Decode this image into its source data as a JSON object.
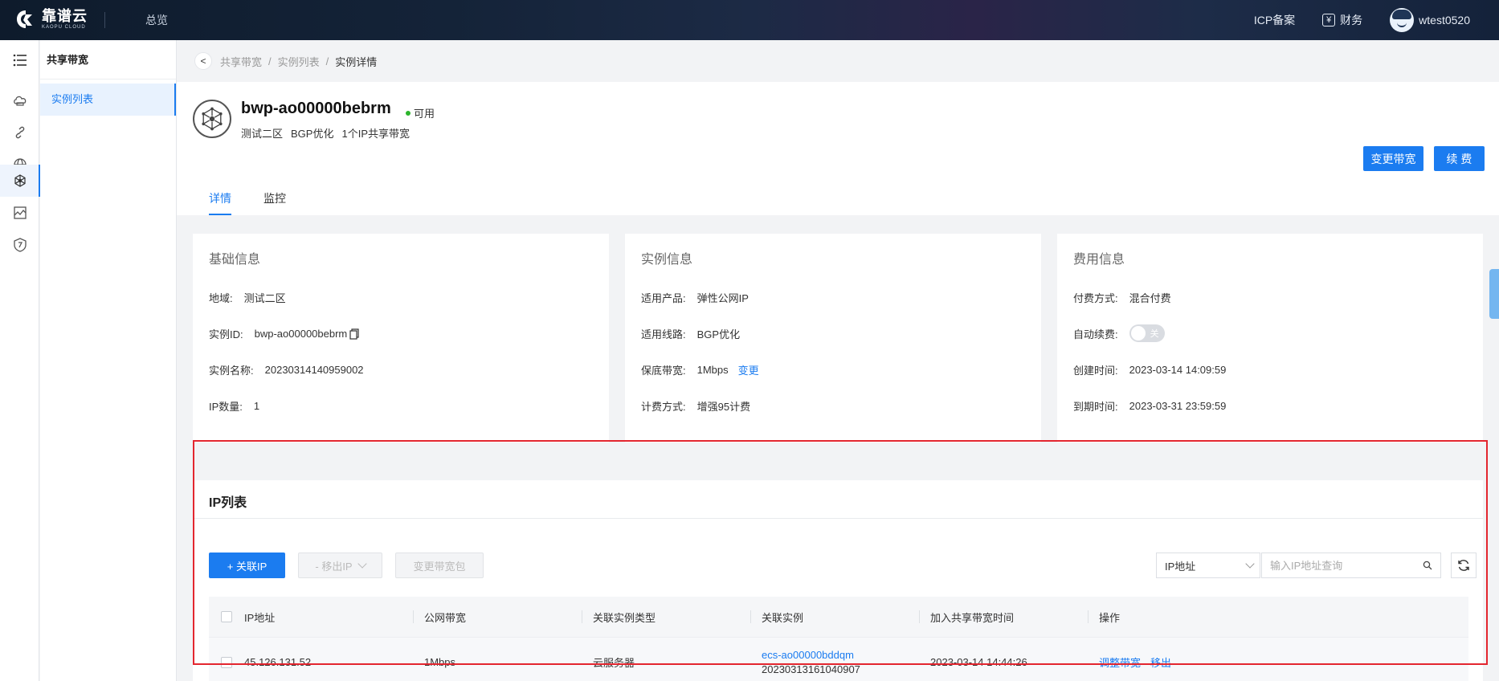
{
  "topbar": {
    "logo_cn": "靠谱云",
    "logo_en": "KAOPU CLOUD",
    "overview": "总览",
    "icp": "ICP备案",
    "finance": "财务",
    "finance_icon": "yen-icon",
    "username": "wtest0520"
  },
  "subnav": {
    "title": "共享带宽",
    "items": [
      {
        "label": "实例列表"
      }
    ]
  },
  "breadcrumb": {
    "back": "<",
    "items": [
      "共享带宽",
      "实例列表",
      "实例详情"
    ],
    "sep": "/"
  },
  "instance": {
    "name": "bwp-ao00000bebrm",
    "status": "可用",
    "status_color": "#2cb52c",
    "region": "测试二区",
    "line": "BGP优化",
    "ip_desc": "1个IP共享带宽",
    "buttons": {
      "change_bw": "变更带宽",
      "renew": "续 费"
    }
  },
  "tabs": [
    "详情",
    "监控"
  ],
  "basic": {
    "title": "基础信息",
    "rows": [
      {
        "label": "地域:",
        "value": "测试二区"
      },
      {
        "label": "实例ID:",
        "value": "bwp-ao00000bebrm"
      },
      {
        "label": "实例名称:",
        "value": "20230314140959002"
      },
      {
        "label": "IP数量:",
        "value": "1"
      }
    ]
  },
  "instance_info": {
    "title": "实例信息",
    "rows": [
      {
        "label": "适用产品:",
        "value": "弹性公网IP"
      },
      {
        "label": "适用线路:",
        "value": "BGP优化"
      },
      {
        "label": "保底带宽:",
        "value": "1Mbps",
        "link": "变更"
      },
      {
        "label": "计费方式:",
        "value": "增强95计费"
      }
    ]
  },
  "billing": {
    "title": "费用信息",
    "rows": [
      {
        "label": "付费方式:",
        "value": "混合付费"
      },
      {
        "label": "自动续费:",
        "value": "关"
      },
      {
        "label": "创建时间:",
        "value": "2023-03-14 14:09:59"
      },
      {
        "label": "到期时间:",
        "value": "2023-03-31 23:59:59"
      }
    ]
  },
  "ip_list": {
    "title": "IP列表",
    "buttons": {
      "attach": "+ 关联IP",
      "detach": "- 移出IP",
      "change_pkg": "变更带宽包"
    },
    "filter_select": "IP地址",
    "search_placeholder": "输入IP地址查询",
    "columns": [
      "IP地址",
      "公网带宽",
      "关联实例类型",
      "关联实例",
      "加入共享带宽时间",
      "操作"
    ],
    "rows": [
      {
        "ip": "45.126.131.52",
        "bandwidth": "1Mbps",
        "type": "云服务器",
        "instance_id": "ecs-ao00000bddqm",
        "instance_name": "20230313161040907",
        "joined": "2023-03-14 14:44:26",
        "ops": [
          "调整带宽",
          "移出"
        ]
      }
    ]
  },
  "colors": {
    "accent": "#1b7cf0",
    "highlight_frame": "#e3262f"
  }
}
